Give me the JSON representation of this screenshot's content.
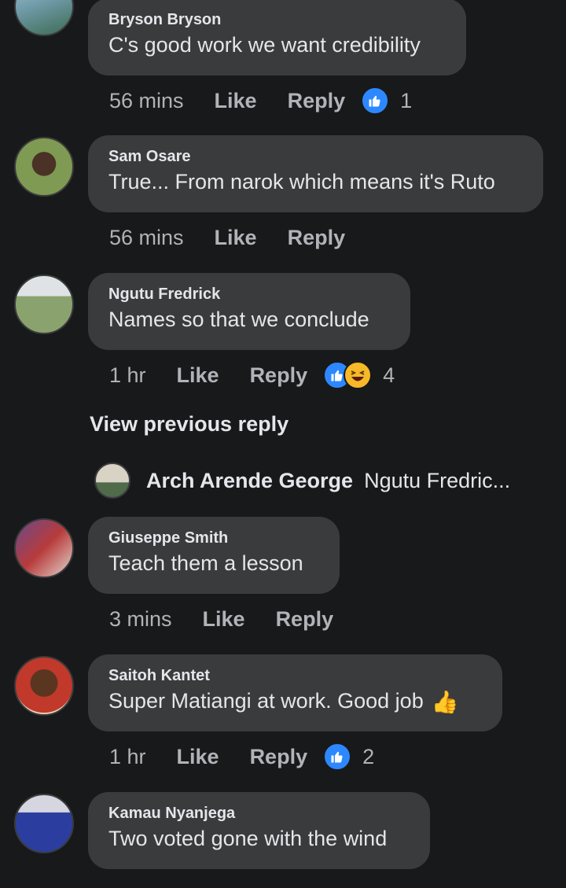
{
  "comments": [
    {
      "author": "Bryson Bryson",
      "text": "C's good work we want credibility",
      "time": "56 mins",
      "like": "Like",
      "reply": "Reply",
      "reactions": "1",
      "avatar_colors": [
        "#7fa7b5",
        "#3d6b52"
      ]
    },
    {
      "author": "Sam Osare",
      "text": "True... From narok which means it's Ruto",
      "time": "56 mins",
      "like": "Like",
      "reply": "Reply",
      "reactions": "",
      "avatar_colors": [
        "#6c8a3a",
        "#4a3326"
      ]
    },
    {
      "author": "Ngutu Fredrick",
      "text": "Names so that we conclude",
      "time": "1 hr",
      "like": "Like",
      "reply": "Reply",
      "reactions": "4",
      "avatar_colors": [
        "#8aa36e",
        "#3a3a3a"
      ]
    },
    {
      "author": "Giuseppe Smith",
      "text": "Teach them a lesson",
      "time": "3 mins",
      "like": "Like",
      "reply": "Reply",
      "reactions": "",
      "avatar_colors": [
        "#a23a3a",
        "#6a4a8a"
      ]
    },
    {
      "author": "Saitoh Kantet",
      "text": "Super Matiangi at work. Good job",
      "emoji": "👍",
      "time": "1 hr",
      "like": "Like",
      "reply": "Reply",
      "reactions": "2",
      "avatar_colors": [
        "#c9a96b",
        "#c0392b"
      ]
    },
    {
      "author": "Kamau Nyanjega",
      "text": "Two voted gone with the wind",
      "avatar_colors": [
        "#c9c9d6",
        "#2b3ea0"
      ]
    }
  ],
  "view_previous": "View previous reply",
  "reply_preview": {
    "author": "Arch Arende George",
    "text": "Ngutu Fredric...",
    "avatar_colors": [
      "#c8c0b0",
      "#4f6b4a"
    ]
  },
  "colors": {
    "background": "#18191a",
    "bubble": "#3a3b3c",
    "meta": "#b0b3b8",
    "like_blue": "#2d88ff",
    "haha_yellow": "#f7b928"
  },
  "icons": [
    "like-reaction-icon",
    "haha-reaction-icon",
    "thumbs-up-emoji"
  ]
}
